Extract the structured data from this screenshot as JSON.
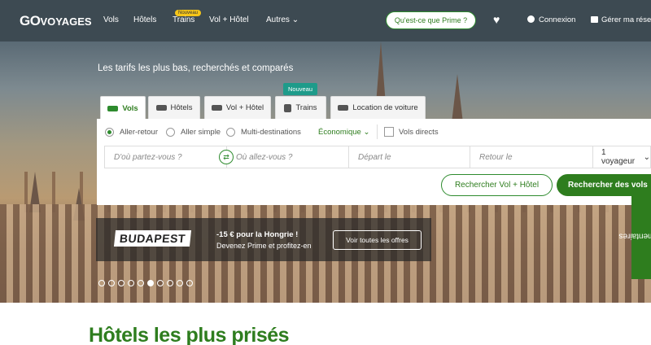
{
  "header": {
    "logo_main": "GO",
    "logo_sub": "VOYAGES",
    "nav": [
      "Vols",
      "Hôtels",
      "Trains",
      "Vol + Hôtel",
      "Autres"
    ],
    "nouveau_badge": "Nouveau",
    "prime_button": "Qu'est-ce que Prime ?",
    "connexion": "Connexion",
    "reservations": "Gérer ma rése"
  },
  "hero": {
    "tagline": "Les tarifs les plus bas, recherchés et comparés"
  },
  "search": {
    "nouveau_tag": "Nouveau",
    "tabs": [
      "Vols",
      "Hôtels",
      "Vol + Hôtel",
      "Trains",
      "Location de voiture"
    ],
    "trip_types": [
      "Aller-retour",
      "Aller simple",
      "Multi-destinations"
    ],
    "cabin_class": "Économique",
    "direct_flights": "Vols directs",
    "from_placeholder": "D'où partez-vous ?",
    "to_placeholder": "Où allez-vous ?",
    "depart_placeholder": "Départ le",
    "return_placeholder": "Retour le",
    "passengers": "1 voyageur",
    "search_package_button": "Rechercher Vol + Hôtel",
    "search_flights_button": "Rechercher des vols"
  },
  "promo": {
    "logo_text": "BUDAPEST",
    "title": "-15 € pour la Hongrie !",
    "subtitle": "Devenez Prime et profitez-en",
    "cta": "Voir toutes les offres",
    "active_slide": 6,
    "total_slides": 10
  },
  "feedback_tab": "Commentaires",
  "section": {
    "title": "Hôtels les plus prisés"
  },
  "colors": {
    "brand_green": "#2e7d1e",
    "header_bg": "#3d4a52",
    "tag_teal": "#1e9b8a"
  }
}
